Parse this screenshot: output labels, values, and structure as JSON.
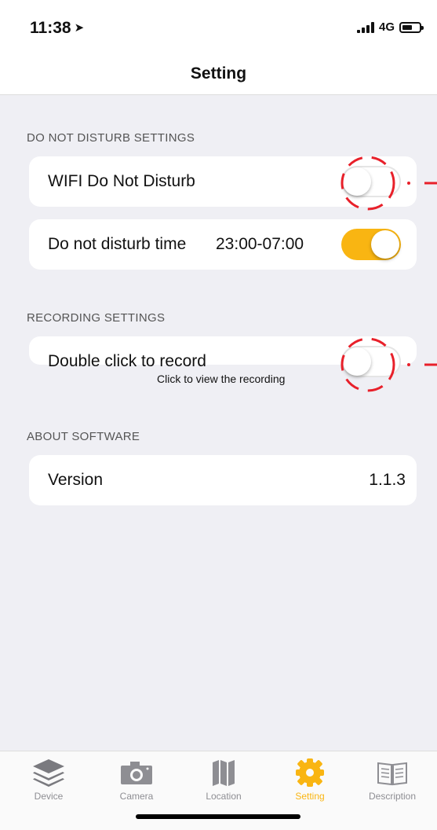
{
  "status": {
    "time": "11:38",
    "network": "4G"
  },
  "nav": {
    "title": "Setting"
  },
  "sections": {
    "dnd": {
      "title": "DO NOT DISTURB SETTINGS"
    },
    "recording": {
      "title": "RECORDING SETTINGS"
    },
    "about": {
      "title": "ABOUT SOFTWARE"
    }
  },
  "rows": {
    "wifi_dnd": {
      "label": "WIFI Do Not Disturb",
      "enabled": false
    },
    "dnd_time": {
      "label": "Do not disturb time",
      "value": "23:00-07:00",
      "enabled": true
    },
    "double_click": {
      "label": "Double click to record",
      "sublabel": "Click to view the recording",
      "enabled": false
    },
    "version": {
      "label": "Version",
      "value": "1.1.3"
    }
  },
  "tabs": [
    {
      "label": "Device",
      "icon": "layers-icon",
      "active": false
    },
    {
      "label": "Camera",
      "icon": "camera-icon",
      "active": false
    },
    {
      "label": "Location",
      "icon": "map-icon",
      "active": false
    },
    {
      "label": "Setting",
      "icon": "gear-icon",
      "active": true
    },
    {
      "label": "Description",
      "icon": "book-icon",
      "active": false
    }
  ],
  "colors": {
    "accent": "#f9b512",
    "annotation": "#e8202a",
    "background": "#efeff4"
  }
}
